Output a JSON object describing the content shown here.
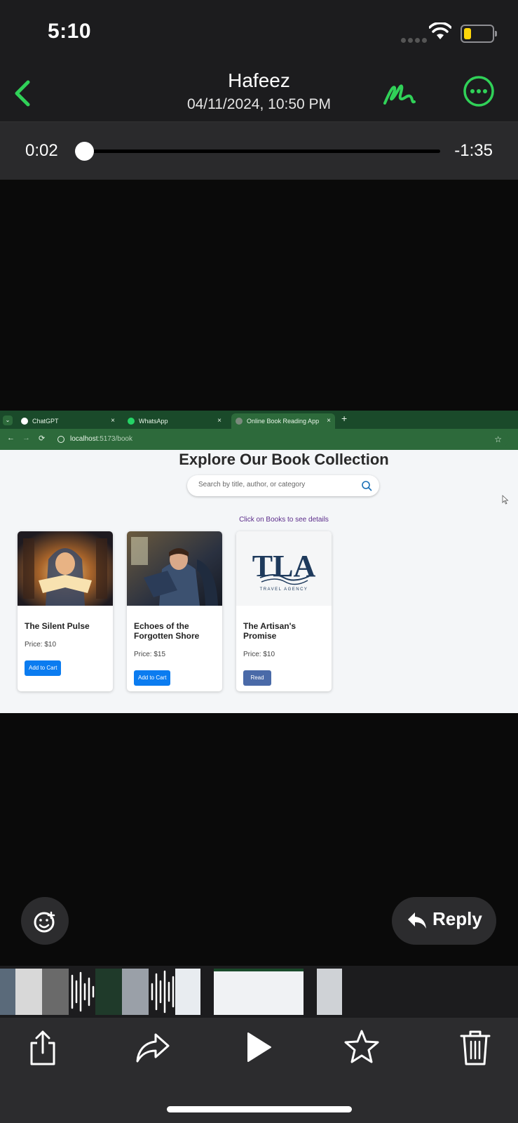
{
  "status_bar": {
    "time": "5:10"
  },
  "header": {
    "contact_name": "Hafeez",
    "timestamp": "04/11/2024, 10:50 PM",
    "accent_color": "#30d158"
  },
  "player": {
    "elapsed": "0:02",
    "remaining": "-1:35",
    "progress": 0.02
  },
  "video": {
    "browser": {
      "tabs": [
        {
          "label": "ChatGPT",
          "close": "×"
        },
        {
          "label": "WhatsApp",
          "close": "×"
        },
        {
          "label": "Online Book Reading App",
          "close": "×"
        }
      ],
      "new_tab": "+",
      "url_host": "localhost",
      "url_path": ":5173/book"
    },
    "page": {
      "heading": "Explore Our Book Collection",
      "search_placeholder": "Search by title, author, or category",
      "hint": "Click on Books to see details",
      "books": [
        {
          "title": "The Silent Pulse",
          "price": "Price: $10",
          "button": "Add to Cart"
        },
        {
          "title": "Echoes of the Forgotten Shore",
          "price": "Price: $15",
          "button": "Add to Cart"
        },
        {
          "title": "The Artisan's Promise",
          "price": "Price: $10",
          "button": "Read"
        }
      ],
      "logo_text": "TLA",
      "logo_subtext": "TRAVEL AGENCY"
    }
  },
  "actions": {
    "reply": "Reply"
  },
  "toolbar": {
    "icons": [
      "share-icon",
      "forward-icon",
      "play-icon",
      "star-icon",
      "trash-icon"
    ]
  }
}
